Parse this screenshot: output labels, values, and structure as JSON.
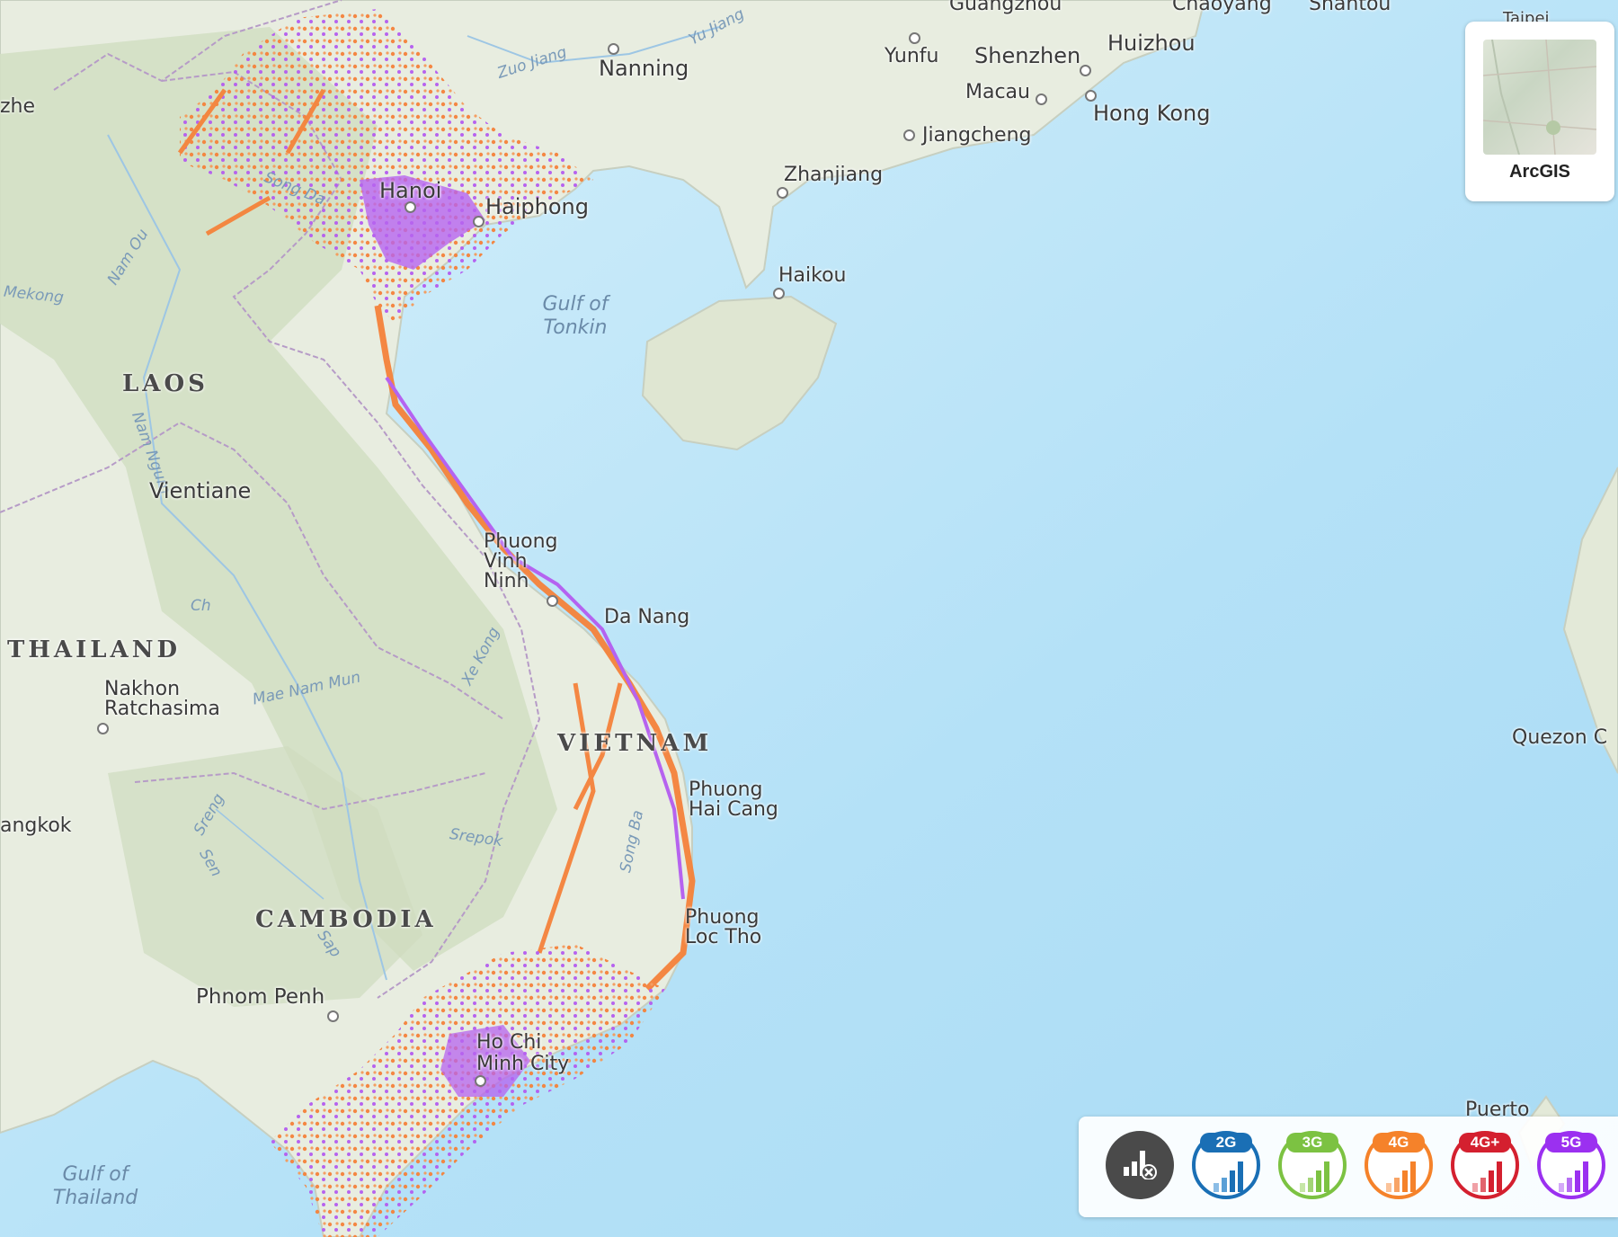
{
  "map": {
    "cities": [
      {
        "name": "Nanning"
      },
      {
        "name": "Yunfu"
      },
      {
        "name": "Shenzhen"
      },
      {
        "name": "Huizhou"
      },
      {
        "name": "Macau"
      },
      {
        "name": "Hong Kong"
      },
      {
        "name": "Jiangcheng"
      },
      {
        "name": "Zhanjiang"
      },
      {
        "name": "Haikou"
      },
      {
        "name": "Hanoi"
      },
      {
        "name": "Haiphong"
      },
      {
        "name": "Vientiane"
      },
      {
        "name": "Phuong Vinh Ninh"
      },
      {
        "name": "Da Nang"
      },
      {
        "name": "Nakhon Ratchasima"
      },
      {
        "name": "angkok"
      },
      {
        "name": "Phuong Hai Cang"
      },
      {
        "name": "Phuong Loc Tho"
      },
      {
        "name": "Phnom Penh"
      },
      {
        "name": "Ho Chi Minh City"
      },
      {
        "name": "Quezon C"
      },
      {
        "name": "Puerto"
      },
      {
        "name": "zhe"
      },
      {
        "name": "Guangzhou"
      },
      {
        "name": "Chaoyang"
      },
      {
        "name": "Shantou"
      },
      {
        "name": "Taipei"
      }
    ],
    "countries": [
      "LAOS",
      "THAILAND",
      "VIETNAM",
      "CAMBODIA"
    ],
    "water": [
      "Gulf of Tonkin",
      "Gulf of Thailand"
    ],
    "rivers": [
      "Zuo Jiang",
      "Yu Jiang",
      "Mekong",
      "Nam Ou",
      "Nam Ngum",
      "Ch",
      "Mae Nam Mun",
      "Xe Kong",
      "Srepok",
      "Sreng",
      "Sen",
      "Song Ba",
      "Song Da",
      "Sap"
    ]
  },
  "basemap": {
    "label": "ArcGIS"
  },
  "legend": {
    "items": [
      {
        "label": "",
        "icon": "no-signal-icon",
        "color": "#4a4a4a"
      },
      {
        "label": "2G",
        "icon": "signal-bars-icon",
        "color": "#1a6fb5"
      },
      {
        "label": "3G",
        "icon": "signal-bars-icon",
        "color": "#7cc242"
      },
      {
        "label": "4G",
        "icon": "signal-bars-icon",
        "color": "#f5822a"
      },
      {
        "label": "4G+",
        "icon": "signal-bars-icon",
        "color": "#d4202f"
      },
      {
        "label": "5G",
        "icon": "signal-bars-icon",
        "color": "#9b30f0"
      }
    ]
  },
  "colors": {
    "sea": "#bfe6f8",
    "land": "#e9eee1",
    "coverage_4g": "#f5823a",
    "coverage_5g": "#b050f0"
  }
}
